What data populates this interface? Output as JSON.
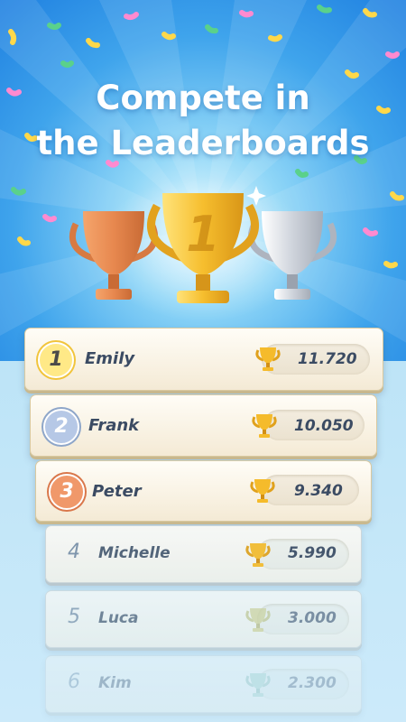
{
  "title": {
    "line1": "Compete in",
    "line2": "the Leaderboards"
  },
  "colors": {
    "gold": "#f2b92a",
    "silver": "#b9c0cb",
    "bronze": "#e58a54",
    "text": "#3b4b63"
  },
  "leaderboard": [
    {
      "rank": "1",
      "name": "Emily",
      "score": "11.720"
    },
    {
      "rank": "2",
      "name": "Frank",
      "score": "10.050"
    },
    {
      "rank": "3",
      "name": "Peter",
      "score": "9.340"
    },
    {
      "rank": "4",
      "name": "Michelle",
      "score": "5.990"
    },
    {
      "rank": "5",
      "name": "Luca",
      "score": "3.000"
    },
    {
      "rank": "6",
      "name": "Kim",
      "score": "2.300"
    }
  ]
}
